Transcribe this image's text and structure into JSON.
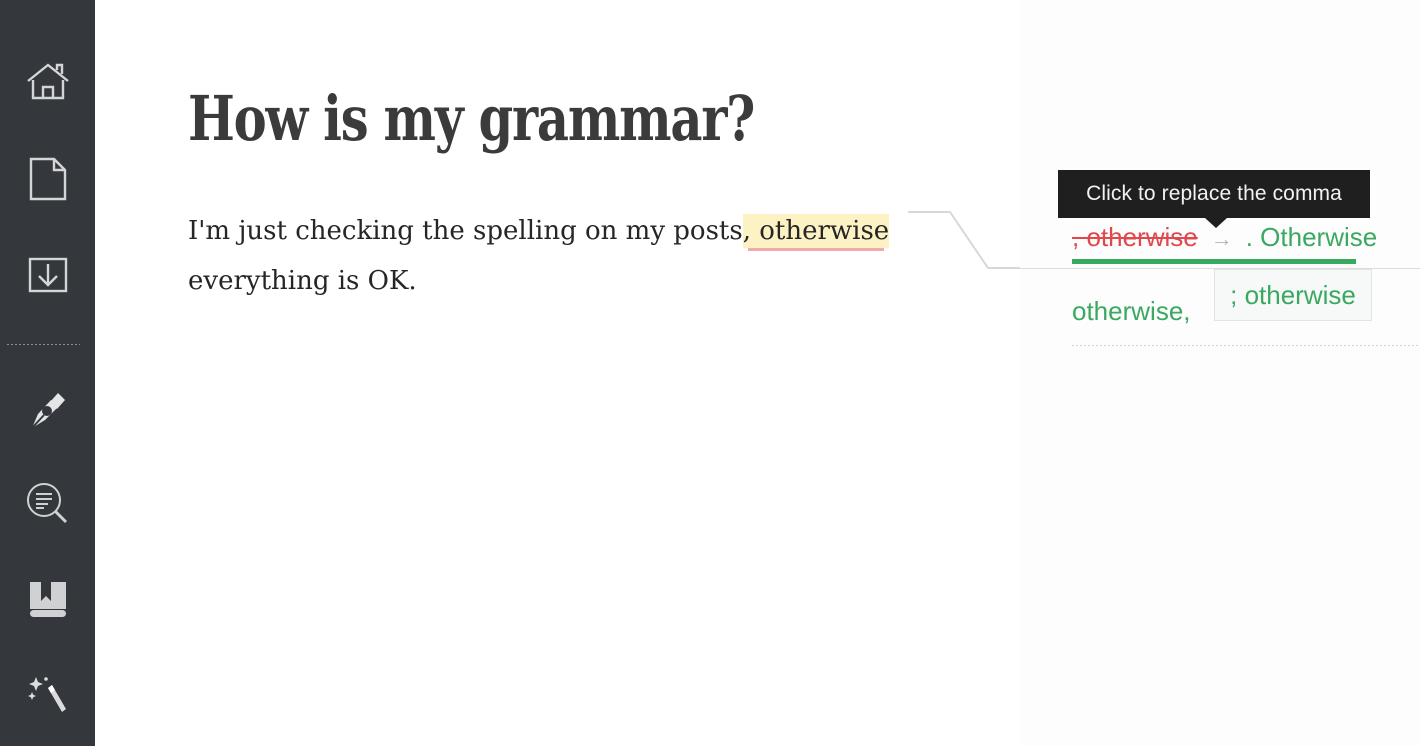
{
  "sidebar": {
    "background_color": "#34373b",
    "items": [
      {
        "icon": "home-icon",
        "label": "Home"
      },
      {
        "icon": "document-icon",
        "label": "Document"
      },
      {
        "icon": "download-icon",
        "label": "Download"
      },
      {
        "icon": "pen-nib-icon",
        "label": "Write"
      },
      {
        "icon": "text-search-icon",
        "label": "Analyze"
      },
      {
        "icon": "book-icon",
        "label": "Dictionary"
      },
      {
        "icon": "magic-wand-icon",
        "label": "Enhance"
      }
    ]
  },
  "document": {
    "title": "How is my grammar?",
    "body_before": "I'm just checking the spelling on my posts",
    "body_highlight": ", otherwise",
    "body_after": " everything is OK.",
    "highlight_background": "#fdf2c4",
    "highlight_underline_color": "#f2aaaa"
  },
  "suggestion_panel": {
    "tooltip": {
      "text": "Click to replace the comma",
      "background": "#1f1f1f",
      "text_color": "#f2f2f2"
    },
    "primary": {
      "original": ", otherwise",
      "arrow": "→",
      "replacement": ". Otherwise",
      "original_color": "#e0484c",
      "replacement_color": "#3aa960",
      "underline_color": "#3aa960"
    },
    "alternatives": [
      {
        "text": "otherwise,",
        "color": "#3aa960",
        "hovered": false
      },
      {
        "text": "; otherwise",
        "color": "#3aa960",
        "hovered": true
      }
    ]
  }
}
